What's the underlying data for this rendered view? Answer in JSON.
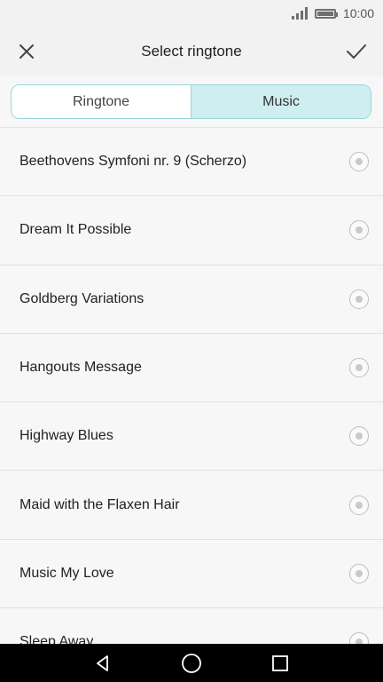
{
  "status_bar": {
    "time": "10:00",
    "icons": [
      "signal-icon",
      "battery-icon"
    ]
  },
  "header": {
    "title": "Select ringtone",
    "left_icon": "close-icon",
    "right_icon": "check-icon"
  },
  "tabs": [
    {
      "label": "Ringtone",
      "selected": false
    },
    {
      "label": "Music",
      "selected": true
    }
  ],
  "list": {
    "items": [
      {
        "label": "Beethovens Symfoni nr. 9 (Scherzo)"
      },
      {
        "label": "Dream It Possible"
      },
      {
        "label": "Goldberg Variations"
      },
      {
        "label": "Hangouts Message"
      },
      {
        "label": "Highway Blues"
      },
      {
        "label": "Maid with the Flaxen Hair"
      },
      {
        "label": "Music My Love"
      },
      {
        "label": "Sleep Away"
      }
    ]
  },
  "navbar": {
    "icons": [
      "back-icon",
      "home-icon",
      "recents-icon"
    ]
  },
  "colors": {
    "accent": "#cfeef1",
    "accent_border": "#9bd6dc"
  }
}
